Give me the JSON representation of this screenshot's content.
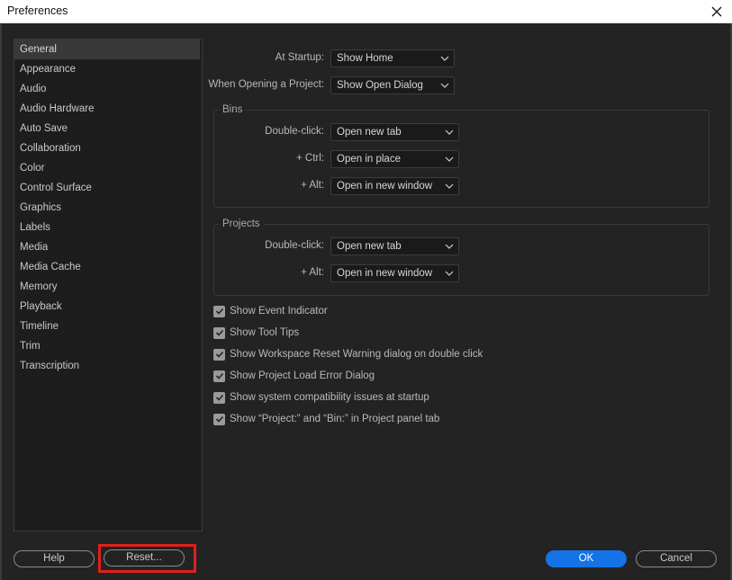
{
  "window": {
    "title": "Preferences"
  },
  "sidebar": {
    "items": [
      {
        "label": "General",
        "active": true
      },
      {
        "label": "Appearance"
      },
      {
        "label": "Audio"
      },
      {
        "label": "Audio Hardware"
      },
      {
        "label": "Auto Save"
      },
      {
        "label": "Collaboration"
      },
      {
        "label": "Color"
      },
      {
        "label": "Control Surface"
      },
      {
        "label": "Graphics"
      },
      {
        "label": "Labels"
      },
      {
        "label": "Media"
      },
      {
        "label": "Media Cache"
      },
      {
        "label": "Memory"
      },
      {
        "label": "Playback"
      },
      {
        "label": "Timeline"
      },
      {
        "label": "Trim"
      },
      {
        "label": "Transcription"
      }
    ]
  },
  "general": {
    "at_startup": {
      "label": "At Startup:",
      "value": "Show Home"
    },
    "when_opening": {
      "label": "When Opening a Project:",
      "value": "Show Open Dialog"
    },
    "bins": {
      "title": "Bins",
      "double_click": {
        "label": "Double-click:",
        "value": "Open new tab"
      },
      "ctrl": {
        "label": "+ Ctrl:",
        "value": "Open in place"
      },
      "alt": {
        "label": "+ Alt:",
        "value": "Open in new window"
      }
    },
    "projects": {
      "title": "Projects",
      "double_click": {
        "label": "Double-click:",
        "value": "Open new tab"
      },
      "alt": {
        "label": "+ Alt:",
        "value": "Open in new window"
      }
    },
    "checkboxes": [
      {
        "label": "Show Event Indicator",
        "checked": true
      },
      {
        "label": "Show Tool Tips",
        "checked": true
      },
      {
        "label": "Show Workspace Reset Warning dialog on double click",
        "checked": true
      },
      {
        "label": "Show Project Load Error Dialog",
        "checked": true
      },
      {
        "label": "Show system compatibility issues at startup",
        "checked": true
      },
      {
        "label": "Show “Project:” and “Bin:” in Project panel tab",
        "checked": true
      }
    ]
  },
  "footer": {
    "help_label": "Help",
    "reset_label": "Reset...",
    "ok_label": "OK",
    "cancel_label": "Cancel"
  },
  "colors": {
    "accent": "#1473e6",
    "highlight": "#e0201b",
    "background": "#232323"
  }
}
